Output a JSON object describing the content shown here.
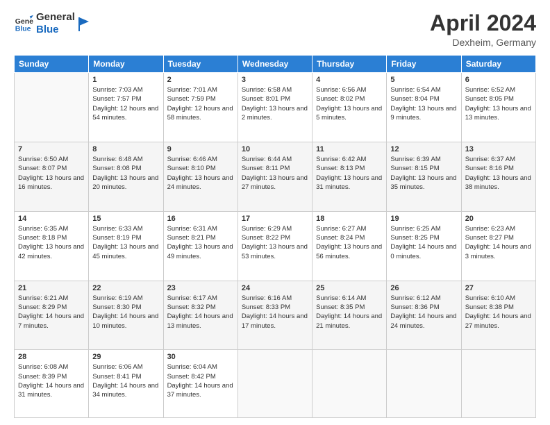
{
  "header": {
    "logo_line1": "General",
    "logo_line2": "Blue",
    "month": "April 2024",
    "location": "Dexheim, Germany"
  },
  "weekdays": [
    "Sunday",
    "Monday",
    "Tuesday",
    "Wednesday",
    "Thursday",
    "Friday",
    "Saturday"
  ],
  "weeks": [
    [
      {
        "day": "",
        "sunrise": "",
        "sunset": "",
        "daylight": ""
      },
      {
        "day": "1",
        "sunrise": "Sunrise: 7:03 AM",
        "sunset": "Sunset: 7:57 PM",
        "daylight": "Daylight: 12 hours and 54 minutes."
      },
      {
        "day": "2",
        "sunrise": "Sunrise: 7:01 AM",
        "sunset": "Sunset: 7:59 PM",
        "daylight": "Daylight: 12 hours and 58 minutes."
      },
      {
        "day": "3",
        "sunrise": "Sunrise: 6:58 AM",
        "sunset": "Sunset: 8:01 PM",
        "daylight": "Daylight: 13 hours and 2 minutes."
      },
      {
        "day": "4",
        "sunrise": "Sunrise: 6:56 AM",
        "sunset": "Sunset: 8:02 PM",
        "daylight": "Daylight: 13 hours and 5 minutes."
      },
      {
        "day": "5",
        "sunrise": "Sunrise: 6:54 AM",
        "sunset": "Sunset: 8:04 PM",
        "daylight": "Daylight: 13 hours and 9 minutes."
      },
      {
        "day": "6",
        "sunrise": "Sunrise: 6:52 AM",
        "sunset": "Sunset: 8:05 PM",
        "daylight": "Daylight: 13 hours and 13 minutes."
      }
    ],
    [
      {
        "day": "7",
        "sunrise": "Sunrise: 6:50 AM",
        "sunset": "Sunset: 8:07 PM",
        "daylight": "Daylight: 13 hours and 16 minutes."
      },
      {
        "day": "8",
        "sunrise": "Sunrise: 6:48 AM",
        "sunset": "Sunset: 8:08 PM",
        "daylight": "Daylight: 13 hours and 20 minutes."
      },
      {
        "day": "9",
        "sunrise": "Sunrise: 6:46 AM",
        "sunset": "Sunset: 8:10 PM",
        "daylight": "Daylight: 13 hours and 24 minutes."
      },
      {
        "day": "10",
        "sunrise": "Sunrise: 6:44 AM",
        "sunset": "Sunset: 8:11 PM",
        "daylight": "Daylight: 13 hours and 27 minutes."
      },
      {
        "day": "11",
        "sunrise": "Sunrise: 6:42 AM",
        "sunset": "Sunset: 8:13 PM",
        "daylight": "Daylight: 13 hours and 31 minutes."
      },
      {
        "day": "12",
        "sunrise": "Sunrise: 6:39 AM",
        "sunset": "Sunset: 8:15 PM",
        "daylight": "Daylight: 13 hours and 35 minutes."
      },
      {
        "day": "13",
        "sunrise": "Sunrise: 6:37 AM",
        "sunset": "Sunset: 8:16 PM",
        "daylight": "Daylight: 13 hours and 38 minutes."
      }
    ],
    [
      {
        "day": "14",
        "sunrise": "Sunrise: 6:35 AM",
        "sunset": "Sunset: 8:18 PM",
        "daylight": "Daylight: 13 hours and 42 minutes."
      },
      {
        "day": "15",
        "sunrise": "Sunrise: 6:33 AM",
        "sunset": "Sunset: 8:19 PM",
        "daylight": "Daylight: 13 hours and 45 minutes."
      },
      {
        "day": "16",
        "sunrise": "Sunrise: 6:31 AM",
        "sunset": "Sunset: 8:21 PM",
        "daylight": "Daylight: 13 hours and 49 minutes."
      },
      {
        "day": "17",
        "sunrise": "Sunrise: 6:29 AM",
        "sunset": "Sunset: 8:22 PM",
        "daylight": "Daylight: 13 hours and 53 minutes."
      },
      {
        "day": "18",
        "sunrise": "Sunrise: 6:27 AM",
        "sunset": "Sunset: 8:24 PM",
        "daylight": "Daylight: 13 hours and 56 minutes."
      },
      {
        "day": "19",
        "sunrise": "Sunrise: 6:25 AM",
        "sunset": "Sunset: 8:25 PM",
        "daylight": "Daylight: 14 hours and 0 minutes."
      },
      {
        "day": "20",
        "sunrise": "Sunrise: 6:23 AM",
        "sunset": "Sunset: 8:27 PM",
        "daylight": "Daylight: 14 hours and 3 minutes."
      }
    ],
    [
      {
        "day": "21",
        "sunrise": "Sunrise: 6:21 AM",
        "sunset": "Sunset: 8:29 PM",
        "daylight": "Daylight: 14 hours and 7 minutes."
      },
      {
        "day": "22",
        "sunrise": "Sunrise: 6:19 AM",
        "sunset": "Sunset: 8:30 PM",
        "daylight": "Daylight: 14 hours and 10 minutes."
      },
      {
        "day": "23",
        "sunrise": "Sunrise: 6:17 AM",
        "sunset": "Sunset: 8:32 PM",
        "daylight": "Daylight: 14 hours and 13 minutes."
      },
      {
        "day": "24",
        "sunrise": "Sunrise: 6:16 AM",
        "sunset": "Sunset: 8:33 PM",
        "daylight": "Daylight: 14 hours and 17 minutes."
      },
      {
        "day": "25",
        "sunrise": "Sunrise: 6:14 AM",
        "sunset": "Sunset: 8:35 PM",
        "daylight": "Daylight: 14 hours and 21 minutes."
      },
      {
        "day": "26",
        "sunrise": "Sunrise: 6:12 AM",
        "sunset": "Sunset: 8:36 PM",
        "daylight": "Daylight: 14 hours and 24 minutes."
      },
      {
        "day": "27",
        "sunrise": "Sunrise: 6:10 AM",
        "sunset": "Sunset: 8:38 PM",
        "daylight": "Daylight: 14 hours and 27 minutes."
      }
    ],
    [
      {
        "day": "28",
        "sunrise": "Sunrise: 6:08 AM",
        "sunset": "Sunset: 8:39 PM",
        "daylight": "Daylight: 14 hours and 31 minutes."
      },
      {
        "day": "29",
        "sunrise": "Sunrise: 6:06 AM",
        "sunset": "Sunset: 8:41 PM",
        "daylight": "Daylight: 14 hours and 34 minutes."
      },
      {
        "day": "30",
        "sunrise": "Sunrise: 6:04 AM",
        "sunset": "Sunset: 8:42 PM",
        "daylight": "Daylight: 14 hours and 37 minutes."
      },
      {
        "day": "",
        "sunrise": "",
        "sunset": "",
        "daylight": ""
      },
      {
        "day": "",
        "sunrise": "",
        "sunset": "",
        "daylight": ""
      },
      {
        "day": "",
        "sunrise": "",
        "sunset": "",
        "daylight": ""
      },
      {
        "day": "",
        "sunrise": "",
        "sunset": "",
        "daylight": ""
      }
    ]
  ]
}
